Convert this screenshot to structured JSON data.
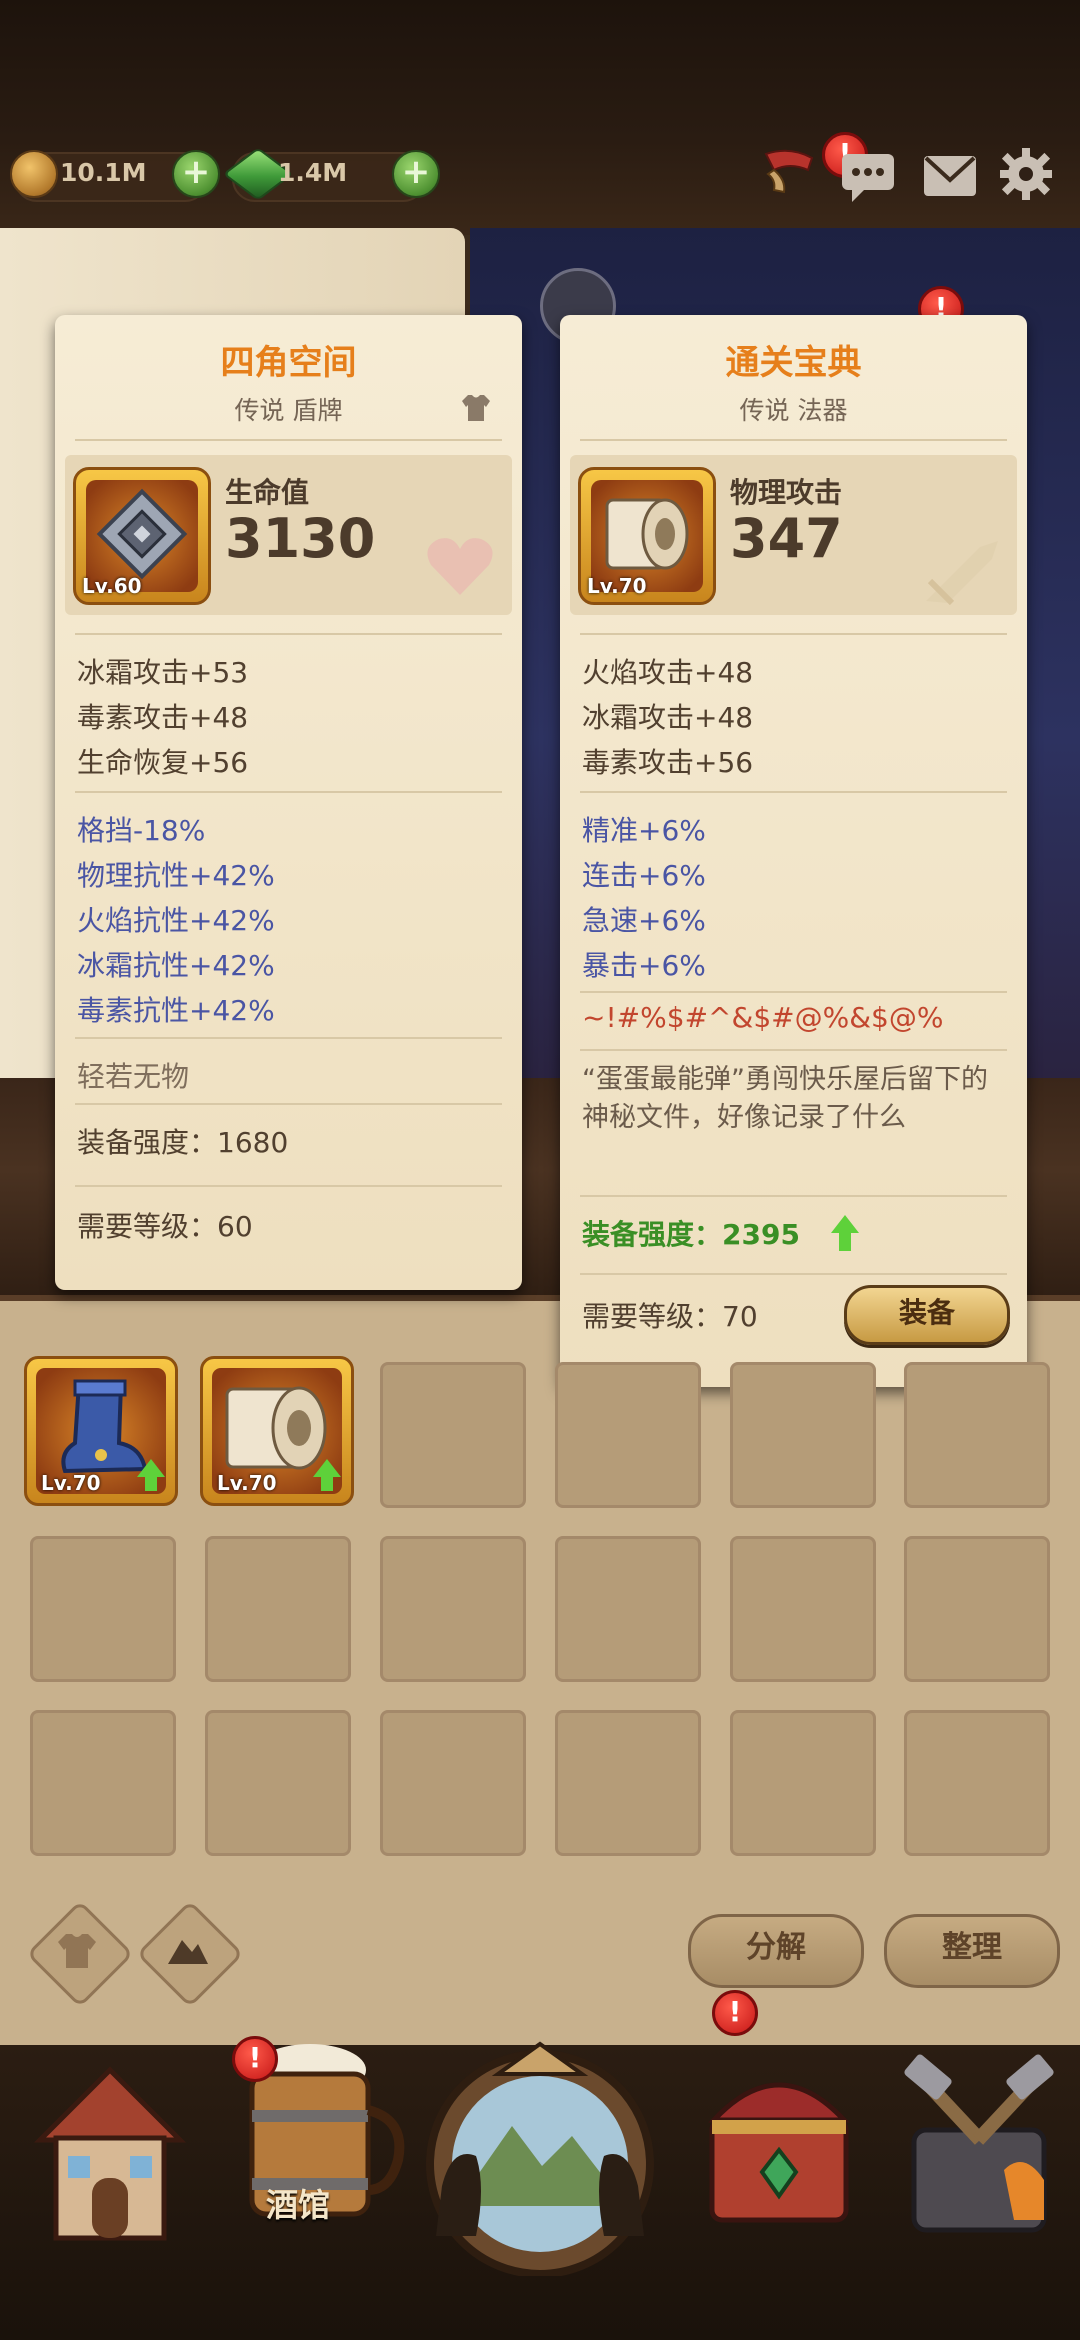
{
  "resources": {
    "coins": "10.1M",
    "gems": "1.4M"
  },
  "left_card": {
    "name": "四角空间",
    "subtitle": "传说 盾牌",
    "level": "Lv.60",
    "main_stat_name": "生命值",
    "main_stat_value": "3130",
    "base_stats": [
      "冰霜攻击+53",
      "毒素攻击+48",
      "生命恢复+56"
    ],
    "bonus_stats": [
      "格挡-18%",
      "物理抗性+42%",
      "火焰抗性+42%",
      "冰霜抗性+42%",
      "毒素抗性+42%"
    ],
    "trait": "轻若无物",
    "power": "装备强度：1680",
    "required_level": "需要等级：60"
  },
  "right_card": {
    "name": "通关宝典",
    "subtitle": "传说 法器",
    "level": "Lv.70",
    "main_stat_name": "物理攻击",
    "main_stat_value": "347",
    "base_stats": [
      "火焰攻击+48",
      "冰霜攻击+48",
      "毒素攻击+56"
    ],
    "bonus_stats": [
      "精准+6%",
      "连击+6%",
      "急速+6%",
      "暴击+6%"
    ],
    "glitch_text": "~!#%$#^&$#@%&$@%",
    "flavor_text": "“蛋蛋最能弹”勇闯快乐屋后留下的神秘文件，好像记录了什么",
    "power": "装备强度：2395",
    "required_level": "需要等级：70",
    "equip_label": "装备"
  },
  "inventory": {
    "items": [
      {
        "name": "boot",
        "level": "Lv.70"
      },
      {
        "name": "scroll",
        "level": "Lv.70"
      }
    ],
    "decompose_label": "分解",
    "sort_label": "整理"
  },
  "nav": {
    "tavern_label": "酒馆"
  },
  "colors": {
    "title_orange": "#e67f1b",
    "bonus_blue": "#4a55a4",
    "power_green": "#3a8f25",
    "badge_red": "#d41a1a"
  }
}
